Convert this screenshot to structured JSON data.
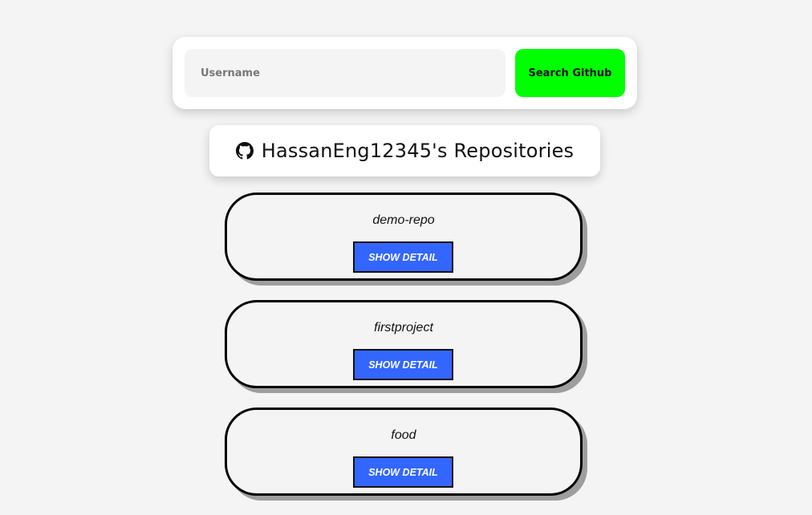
{
  "search": {
    "placeholder": "Username",
    "value": "",
    "button_label": "Search Github"
  },
  "header": {
    "icon": "github-icon",
    "title": "HassanEng12345's Repositories"
  },
  "repositories": [
    {
      "name": "demo-repo",
      "button_label": "SHOW DETAIL"
    },
    {
      "name": "firstproject",
      "button_label": "SHOW DETAIL"
    },
    {
      "name": "food",
      "button_label": "SHOW DETAIL"
    }
  ],
  "colors": {
    "background": "#f4f4f4",
    "search_button": "#00ff00",
    "detail_button": "#3366ff"
  }
}
